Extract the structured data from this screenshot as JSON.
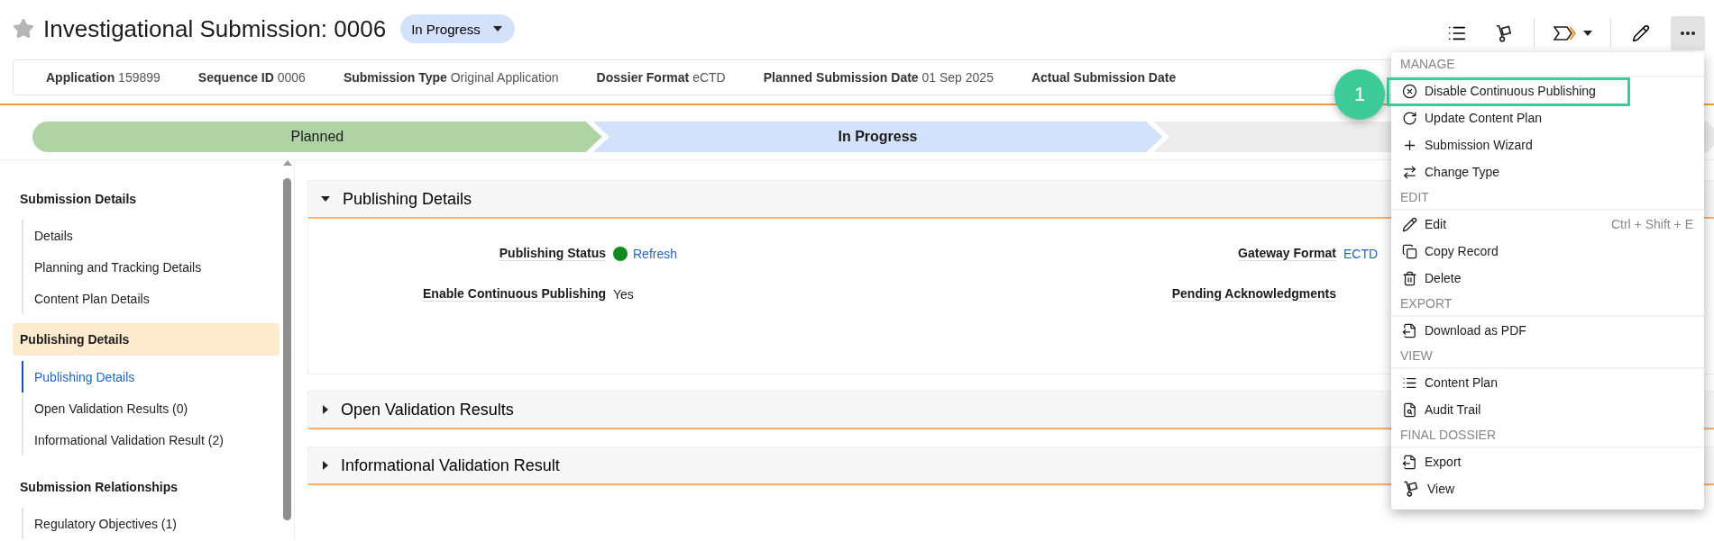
{
  "header": {
    "title": "Investigational Submission: 0006",
    "status_badge": "In Progress",
    "starred": false
  },
  "info_bar": [
    {
      "label": "Application",
      "value": "159899"
    },
    {
      "label": "Sequence ID",
      "value": "0006"
    },
    {
      "label": "Submission Type",
      "value": "Original Application"
    },
    {
      "label": "Dossier Format",
      "value": "eCTD"
    },
    {
      "label": "Planned Submission Date",
      "value": "01 Sep 2025"
    },
    {
      "label": "Actual Submission Date"
    }
  ],
  "stepper": [
    {
      "label": "Planned",
      "completed": true,
      "selected": false
    },
    {
      "label": "In Progress",
      "completed": false,
      "selected": true
    },
    {
      "completed": false,
      "selected": false
    }
  ],
  "sidebar": [
    {
      "title": "Submission Details",
      "selected": false,
      "items": [
        {
          "label": "Details",
          "selected": false
        },
        {
          "label": "Planning and Tracking Details",
          "selected": false
        },
        {
          "label": "Content Plan Details",
          "selected": false
        }
      ]
    },
    {
      "title": "Publishing Details",
      "selected": true,
      "items": [
        {
          "label": "Publishing Details",
          "selected": true
        },
        {
          "label": "Open Validation Results (0)",
          "selected": false
        },
        {
          "label": "Informational Validation Result (2)",
          "selected": false
        }
      ]
    },
    {
      "title": "Submission Relationships",
      "selected": false,
      "items": [
        {
          "label": "Regulatory Objectives (1)",
          "selected": false
        }
      ]
    }
  ],
  "sections": [
    {
      "title": "Publishing Details",
      "expanded": true,
      "fields": [
        {
          "label": "Publishing Status",
          "kind": "status",
          "link": "Refresh"
        },
        {
          "label": "Gateway Format",
          "kind": "link",
          "value": "ECTD"
        },
        {
          "label": "Enable Continuous Publishing",
          "kind": "text",
          "value": "Yes"
        },
        {
          "label": "Pending Acknowledgments",
          "kind": "text"
        }
      ]
    },
    {
      "title": "Open Validation Results",
      "expanded": false
    },
    {
      "title": "Informational Validation Result",
      "expanded": false
    }
  ],
  "menu": [
    {
      "title": "MANAGE",
      "items": [
        {
          "label": "Disable Continuous Publishing"
        },
        {
          "label": "Update Content Plan"
        },
        {
          "label": "Submission Wizard"
        },
        {
          "label": "Change Type"
        }
      ]
    },
    {
      "title": "EDIT",
      "items": [
        {
          "label": "Edit",
          "shortcut": "Ctrl + Shift + E"
        },
        {
          "label": "Copy Record"
        },
        {
          "label": "Delete"
        }
      ]
    },
    {
      "title": "EXPORT",
      "items": [
        {
          "label": "Download as PDF"
        }
      ]
    },
    {
      "title": "VIEW",
      "items": [
        {
          "label": "Content Plan"
        },
        {
          "label": "Audit Trail"
        }
      ]
    },
    {
      "title": "FINAL DOSSIER",
      "items": [
        {
          "label": "Export"
        },
        {
          "label": "View"
        }
      ]
    }
  ],
  "callout": {
    "number": "1"
  }
}
